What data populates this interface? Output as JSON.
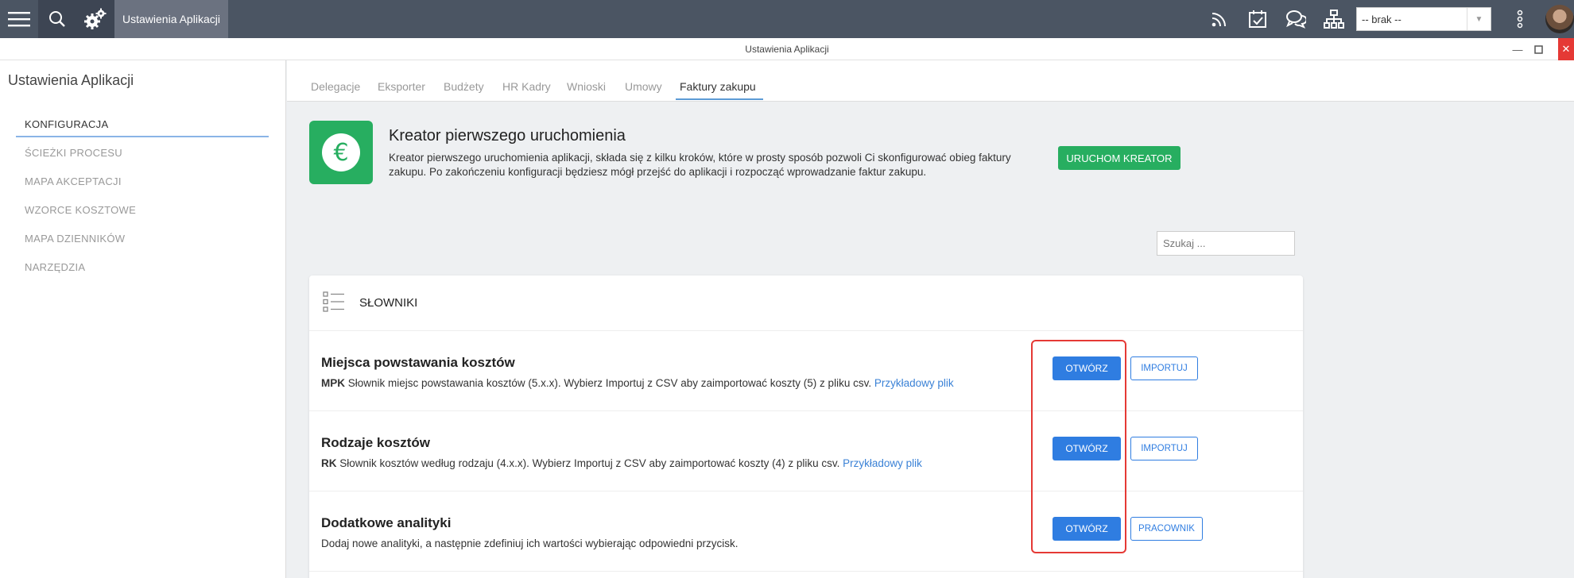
{
  "topbar": {
    "app_label": "Ustawienia Aplikacji",
    "select_value": "-- brak --"
  },
  "window": {
    "title": "Ustawienia Aplikacji"
  },
  "sidebar": {
    "title": "Ustawienia Aplikacji",
    "items": [
      {
        "label": "KONFIGURACJA"
      },
      {
        "label": "ŚCIEŻKI PROCESU"
      },
      {
        "label": "MAPA AKCEPTACJI"
      },
      {
        "label": "WZORCE KOSZTOWE"
      },
      {
        "label": "MAPA DZIENNIKÓW"
      },
      {
        "label": "NARZĘDZIA"
      }
    ]
  },
  "tabs": [
    {
      "label": "Delegacje"
    },
    {
      "label": "Eksporter"
    },
    {
      "label": "Budżety"
    },
    {
      "label": "HR Kadry"
    },
    {
      "label": "Wnioski"
    },
    {
      "label": "Umowy"
    },
    {
      "label": "Faktury zakupu"
    }
  ],
  "wizard": {
    "icon_glyph": "€",
    "title": "Kreator pierwszego uruchomienia",
    "description": "Kreator pierwszego uruchomienia aplikacji, składa się z kilku kroków, które w prosty sposób pozwoli Ci skonfigurować obieg faktury zakupu. Po zakończeniu konfiguracji będziesz mógł przejść do aplikacji i rozpocząć wprowadzanie faktur zakupu.",
    "button_label": "URUCHOM KREATOR"
  },
  "search": {
    "placeholder": "Szukaj ..."
  },
  "dictionaries": {
    "title": "SŁOWNIKI",
    "rows": [
      {
        "title": "Miejsca powstawania kosztów",
        "code": "MPK",
        "description": " Słownik miejsc powstawania kosztów (5.x.x). Wybierz Importuj z CSV aby zaimportować koszty (5) z pliku csv. ",
        "link": "Przykładowy plik",
        "open_label": "OTWÓRZ",
        "secondary_label": "IMPORTUJ"
      },
      {
        "title": "Rodzaje kosztów",
        "code": "RK",
        "description": " Słownik kosztów według rodzaju (4.x.x). Wybierz Importuj z CSV aby zaimportować koszty (4) z pliku csv. ",
        "link": "Przykładowy plik",
        "open_label": "OTWÓRZ",
        "secondary_label": "IMPORTUJ"
      },
      {
        "title": "Dodatkowe analityki",
        "code": "",
        "description": "Dodaj nowe analityki, a następnie zdefiniuj ich wartości wybierając odpowiedni przycisk.",
        "link": "",
        "open_label": "OTWÓRZ",
        "secondary_label": "PRACOWNIK"
      }
    ]
  }
}
